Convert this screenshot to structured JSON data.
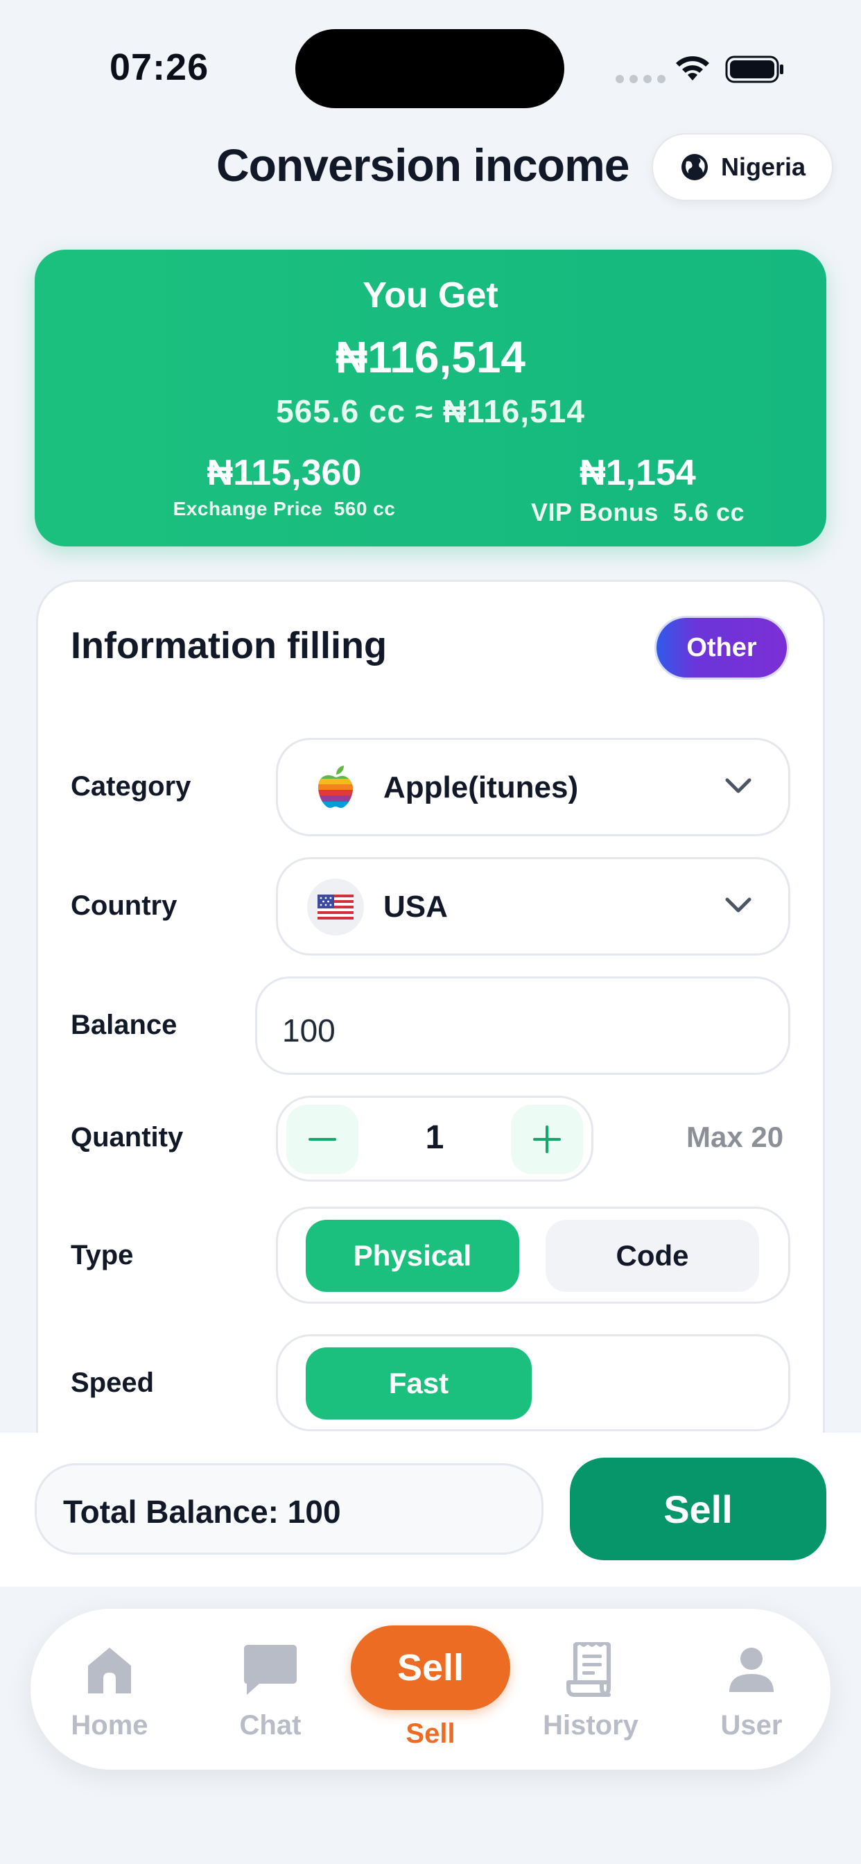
{
  "status_bar": {
    "time": "07:26"
  },
  "header": {
    "title": "Conversion income",
    "region": "Nigeria",
    "region_icon": "globe-icon"
  },
  "summary": {
    "title": "You Get",
    "amount": "₦116,514",
    "rate": "565.6 cc  ≈  ₦116,514",
    "exchange": {
      "amount": "₦115,360",
      "label": "Exchange Price",
      "cc": "560 cc"
    },
    "vip": {
      "amount": "₦1,154",
      "label": "VIP Bonus",
      "cc": "5.6 cc"
    }
  },
  "form": {
    "title": "Information filling",
    "other_label": "Other",
    "category": {
      "label": "Category",
      "value": "Apple(itunes)",
      "icon": "apple-logo-icon"
    },
    "country": {
      "label": "Country",
      "value": "USA",
      "icon": "us-flag-icon"
    },
    "balance": {
      "label": "Balance",
      "value": "100"
    },
    "quantity": {
      "label": "Quantity",
      "value": "1",
      "max": "Max 20"
    },
    "type": {
      "label": "Type",
      "options": [
        "Physical",
        "Code"
      ],
      "selected": "Physical"
    },
    "speed": {
      "label": "Speed",
      "options": [
        "Fast"
      ],
      "selected": "Fast"
    }
  },
  "action_bar": {
    "total": "Total Balance: 100",
    "sell_label": "Sell"
  },
  "tab_bar": {
    "items": [
      {
        "label": "Home",
        "icon": "home-icon"
      },
      {
        "label": "Chat",
        "icon": "chat-icon"
      },
      {
        "label": "Sell",
        "icon": "sell-icon"
      },
      {
        "label": "History",
        "icon": "receipt-icon"
      },
      {
        "label": "User",
        "icon": "user-icon"
      }
    ],
    "fab_label": "Sell",
    "active": "Sell",
    "active_color": "#ed6c23"
  },
  "colors": {
    "brand_green": "#1cc07e",
    "sell_green": "#07956a",
    "accent_orange": "#ed6c23"
  }
}
